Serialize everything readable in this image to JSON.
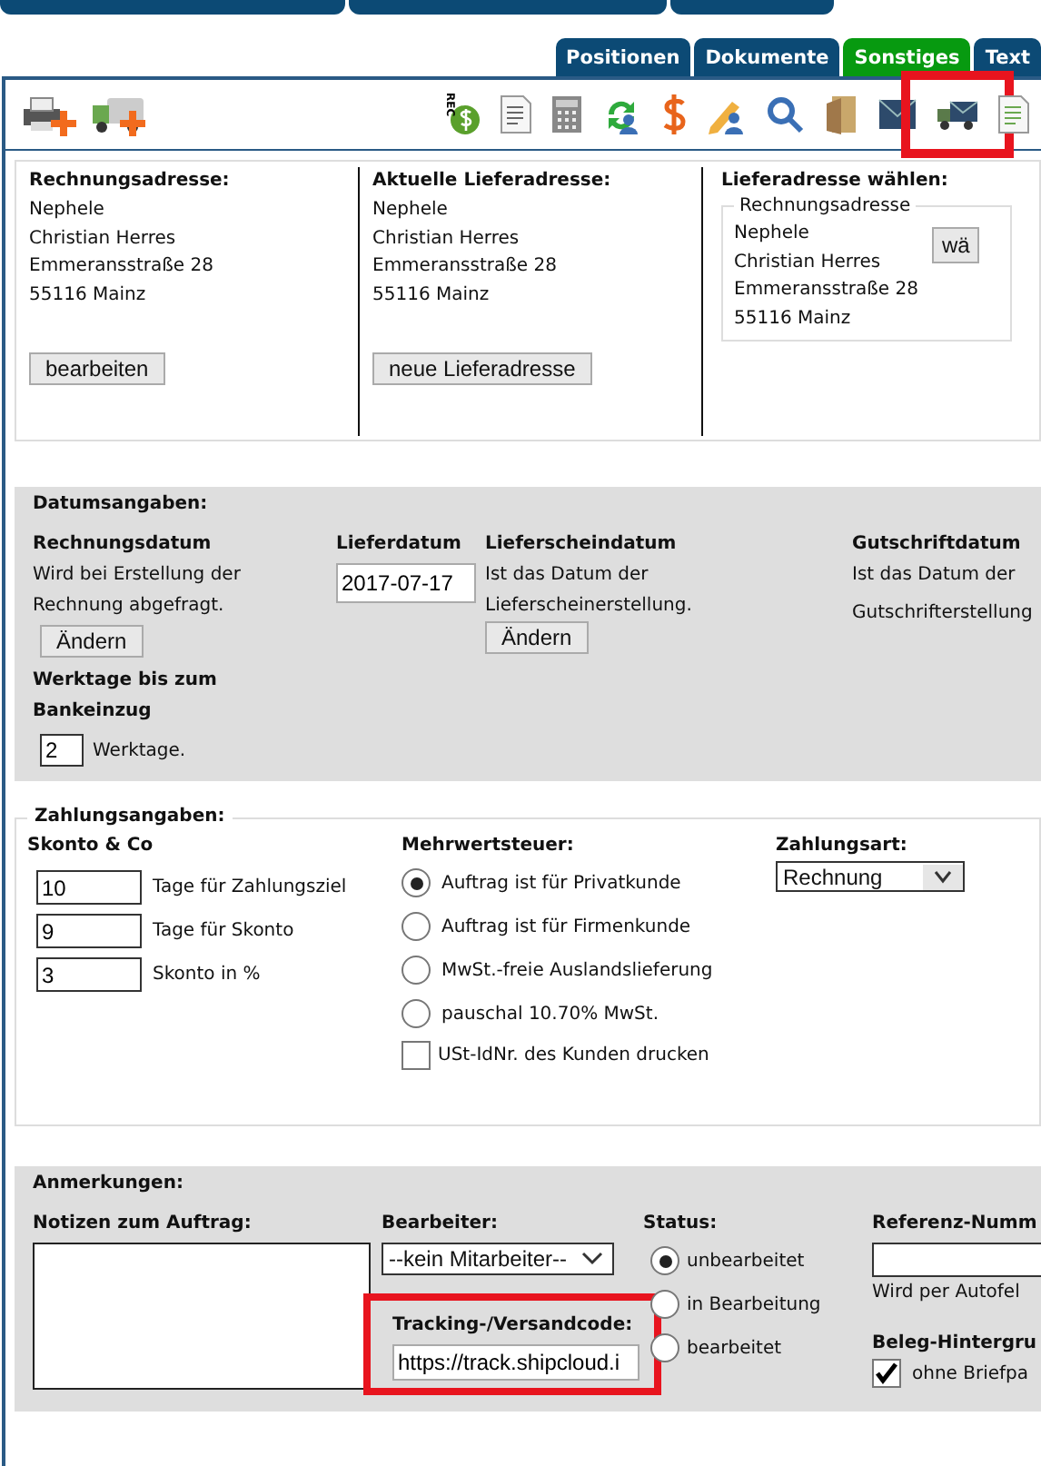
{
  "tabs": [
    {
      "label": "Positionen",
      "selected": false
    },
    {
      "label": "Dokumente",
      "selected": false
    },
    {
      "label": "Sonstiges",
      "selected": true
    },
    {
      "label": "Text",
      "selected": false
    }
  ],
  "toolbar": {
    "left": [
      {
        "kind": "printer-add",
        "highlighted": false
      },
      {
        "kind": "truck-add",
        "highlighted": false
      }
    ],
    "right": [
      {
        "kind": "money-bag",
        "label": "REC",
        "highlighted": false
      },
      {
        "kind": "document",
        "highlighted": false
      },
      {
        "kind": "calculator",
        "highlighted": false
      },
      {
        "kind": "user-refresh",
        "highlighted": false
      },
      {
        "kind": "dollar",
        "highlighted": false
      },
      {
        "kind": "user-edit",
        "highlighted": false
      },
      {
        "kind": "user-search",
        "highlighted": false
      },
      {
        "kind": "folder",
        "highlighted": false
      },
      {
        "kind": "envelope",
        "highlighted": false
      },
      {
        "kind": "truck-mail",
        "highlighted": true
      },
      {
        "kind": "document-green",
        "highlighted": false
      }
    ]
  },
  "addresses": {
    "billing": {
      "title": "Rechnungsadresse:",
      "lines": [
        "Nephele",
        "Christian Herres",
        "Emmeransstraße 28",
        "55116 Mainz"
      ],
      "button": "bearbeiten"
    },
    "current_delivery": {
      "title": "Aktuelle Lieferadresse:",
      "lines": [
        "Nephele",
        "Christian Herres",
        "Emmeransstraße 28",
        "55116 Mainz"
      ],
      "button": "neue Lieferadresse"
    },
    "choose": {
      "title": "Lieferadresse wählen:",
      "legend": "Rechnungsadresse",
      "lines": [
        "Nephele",
        "Christian Herres",
        "Emmeransstraße 28",
        "55116 Mainz"
      ],
      "button": "wä"
    }
  },
  "dates": {
    "title": "Datumsangaben:",
    "invoice_date": {
      "title": "Rechnungsdatum",
      "text": "Wird bei Erstellung der Rechnung abgefragt.",
      "button": "Ändern"
    },
    "delivery_date": {
      "title": "Lieferdatum",
      "value": "2017-07-17"
    },
    "delivery_note_date": {
      "title": "Lieferscheindatum",
      "text": "Ist das Datum der Lieferscheinerstellung.",
      "button": "Ändern"
    },
    "credit_date": {
      "title": "Gutschriftdatum",
      "text": "Ist das Datum der",
      "text2": "Gutschrifterstellung"
    },
    "workdays": {
      "title": "Werktage bis zum Bankeinzug",
      "value": "2",
      "unit": "Werktage."
    }
  },
  "payment": {
    "title": "Zahlungsangaben:",
    "skonto_title": "Skonto & Co",
    "skonto": [
      {
        "value": "10",
        "label": "Tage für Zahlungsziel"
      },
      {
        "value": "9",
        "label": "Tage für Skonto"
      },
      {
        "value": "3",
        "label": "Skonto in %"
      }
    ],
    "vat_title": "Mehrwertsteuer:",
    "vat": [
      {
        "kind": "radio",
        "label": "Auftrag ist für Privatkunde",
        "selected": true
      },
      {
        "kind": "radio",
        "label": "Auftrag ist für Firmenkunde",
        "selected": false
      },
      {
        "kind": "radio",
        "label": "MwSt.-freie Auslandslieferung",
        "selected": false
      },
      {
        "kind": "radio",
        "label": "pauschal 10.70% MwSt.",
        "selected": false
      },
      {
        "kind": "checkbox",
        "label": "USt-IdNr. des Kunden drucken",
        "checked": false
      }
    ],
    "method_title": "Zahlungsart:",
    "method": "Rechnung"
  },
  "notes": {
    "title": "Anmerkungen:",
    "notes_title": "Notizen zum Auftrag:",
    "editor_title": "Bearbeiter:",
    "editor": "--kein Mitarbeiter--",
    "tracking": {
      "title": "Tracking-/Versandcode:",
      "value": "https://track.shipcloud.i",
      "highlighted": true
    },
    "status_title": "Status:",
    "status": [
      {
        "label": "unbearbeitet",
        "selected": true
      },
      {
        "label": "in Bearbeitung",
        "selected": false
      },
      {
        "label": "bearbeitet",
        "selected": false
      }
    ],
    "reference_title": "Referenz-Numm",
    "reference_hint": "Wird per Autofel",
    "background_title": "Beleg-Hintergru",
    "background_option": {
      "label": "ohne Briefpa",
      "checked": true
    }
  }
}
